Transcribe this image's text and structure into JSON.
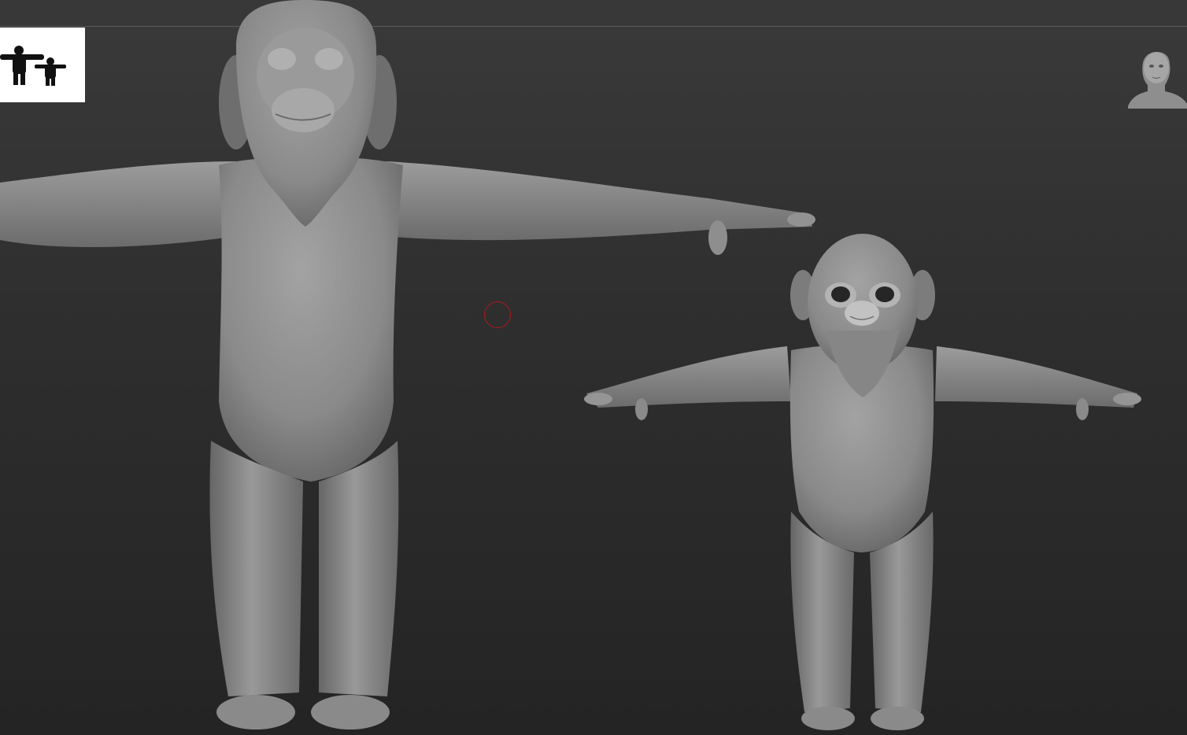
{
  "app": {
    "viewport_background": "#2c2c2c",
    "model_color": "#8a8a8a",
    "cursor_color": "#b01818",
    "accent_arrow_color": "#e01010"
  },
  "viewport": {
    "thumbnail_icon": "silhouette-pair-icon",
    "navigator_icon": "head-bust-icon",
    "brush_cursor_icon": "brush-cursor-ring-icon",
    "models": [
      {
        "id": "adult-ape-model"
      },
      {
        "id": "baby-ape-model"
      }
    ]
  }
}
